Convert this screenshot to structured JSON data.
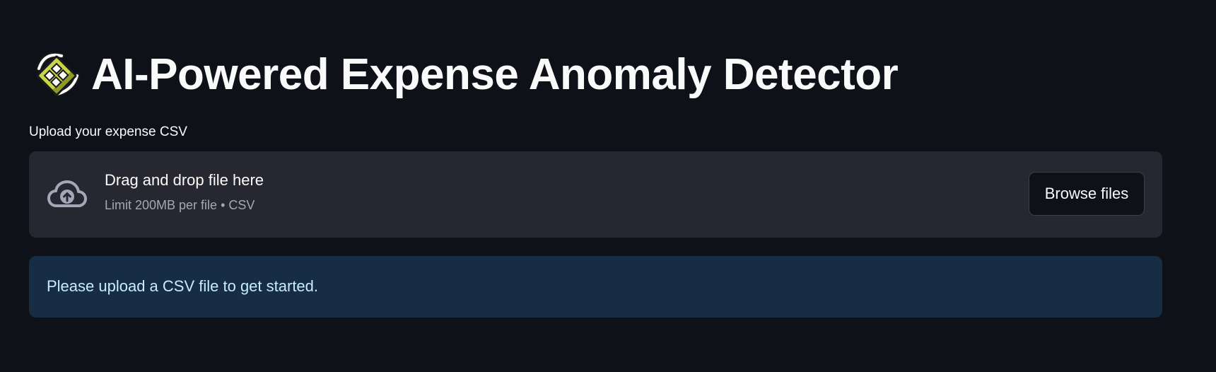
{
  "page": {
    "title": "AI-Powered Expense Anomaly Detector",
    "title_icon": "satellite-icon"
  },
  "uploader": {
    "label": "Upload your expense CSV",
    "drop_title": "Drag and drop file here",
    "drop_limit": "Limit 200MB per file • CSV",
    "browse_label": "Browse files",
    "icon": "cloud-upload-icon"
  },
  "info": {
    "message": "Please upload a CSV file to get started."
  },
  "colors": {
    "background": "#0e1117",
    "dropzone": "#262730",
    "info_background": "#172d43",
    "info_text": "#c7ebff"
  }
}
